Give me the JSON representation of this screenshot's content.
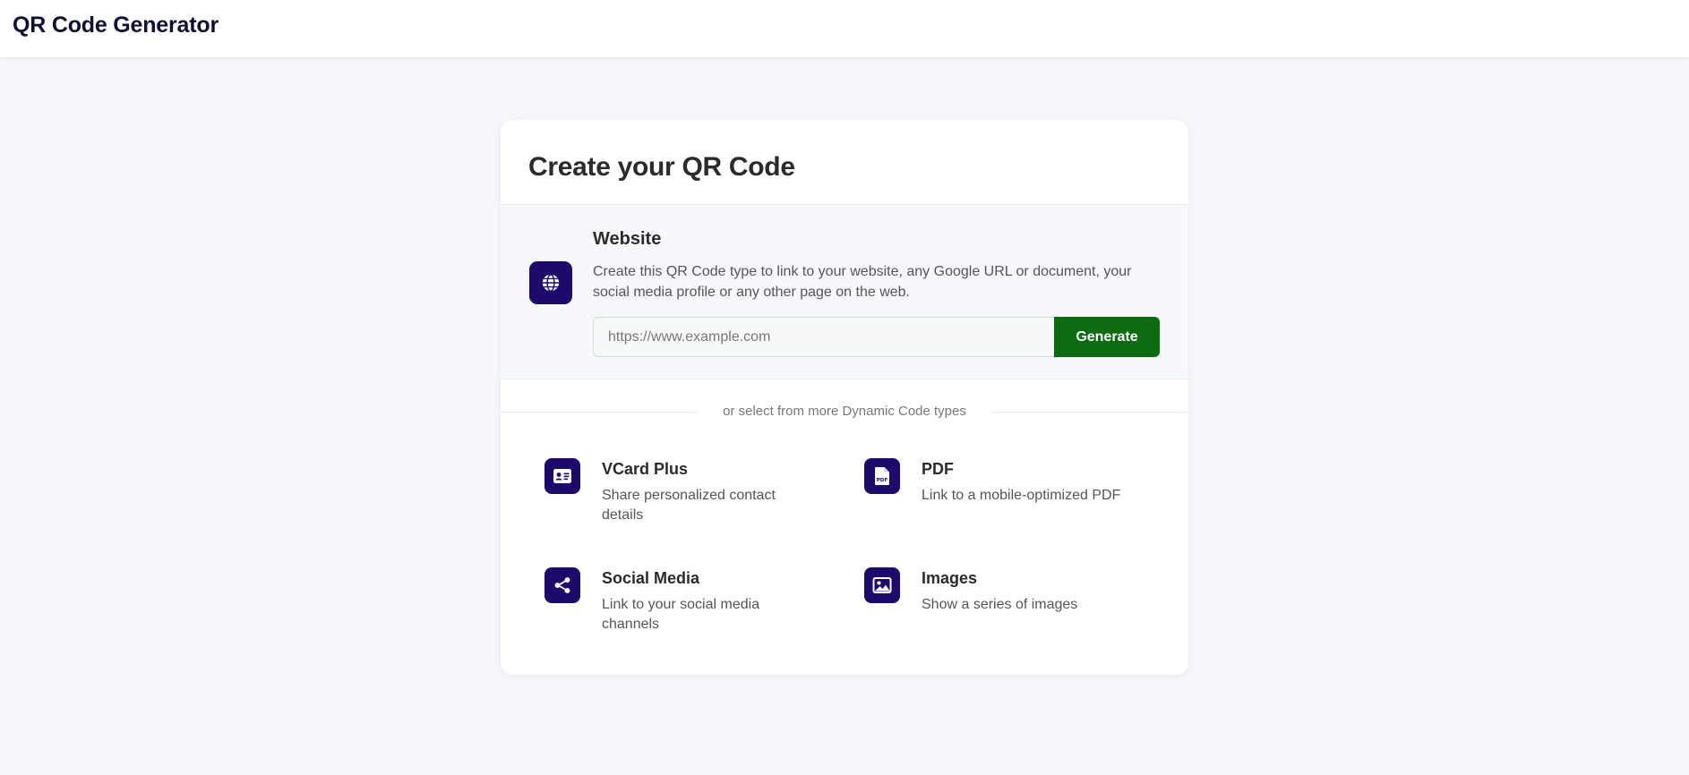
{
  "header": {
    "brand": "QR Code Generator"
  },
  "card": {
    "title": "Create your QR Code",
    "website": {
      "icon": "globe-icon",
      "title": "Website",
      "description": "Create this QR Code type to link to your website, any Google URL or document, your social media profile or any other page on the web.",
      "input_value": "",
      "input_placeholder": "https://www.example.com",
      "button_label": "Generate"
    },
    "divider_text": "or select from more Dynamic Code types",
    "types": [
      {
        "icon": "vcard-icon",
        "title": "VCard Plus",
        "description": "Share personalized contact details"
      },
      {
        "icon": "pdf-icon",
        "title": "PDF",
        "description": "Link to a mobile-optimized PDF"
      },
      {
        "icon": "share-icon",
        "title": "Social Media",
        "description": "Link to your social media channels"
      },
      {
        "icon": "image-icon",
        "title": "Images",
        "description": "Show a series of images"
      }
    ]
  },
  "colors": {
    "icon_background": "#1d0a6b",
    "button_background": "#0c6b0f",
    "page_background": "#f6f7fb"
  }
}
